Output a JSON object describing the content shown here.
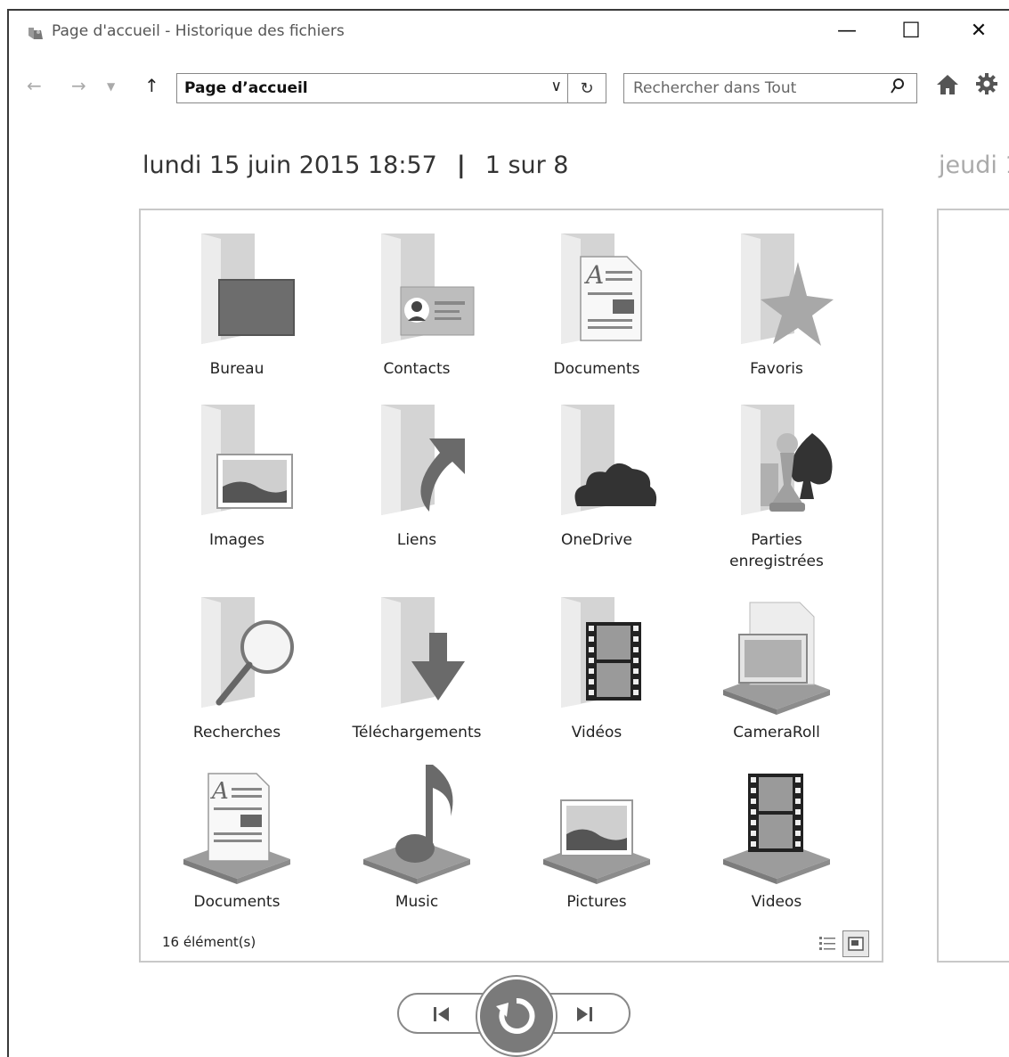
{
  "window": {
    "title": "Page d'accueil - Historique des fichiers",
    "minimize_glyph": "—",
    "maximize_glyph": "☐",
    "close_glyph": "✕"
  },
  "nav": {
    "back_icon": "back-arrow-icon",
    "forward_icon": "forward-arrow-icon",
    "up_icon": "up-arrow-icon",
    "address": "Page d’accueil",
    "search_placeholder": "Rechercher dans Tout"
  },
  "snapshot": {
    "date": "lundi 15 juin 2015 18:57",
    "separator": "|",
    "position": "1 sur 8",
    "next_date_partial": "jeudi 1"
  },
  "items": [
    {
      "label": "Bureau",
      "icon": "desktop-folder-icon"
    },
    {
      "label": "Contacts",
      "icon": "contacts-folder-icon"
    },
    {
      "label": "Documents",
      "icon": "documents-folder-icon"
    },
    {
      "label": "Favoris",
      "icon": "favorites-folder-icon"
    },
    {
      "label": "Images",
      "icon": "pictures-folder-icon"
    },
    {
      "label": "Liens",
      "icon": "links-folder-icon"
    },
    {
      "label": "OneDrive",
      "icon": "onedrive-folder-icon"
    },
    {
      "label": "Parties enregistrées",
      "icon": "saved-games-folder-icon"
    },
    {
      "label": "Recherches",
      "icon": "searches-folder-icon"
    },
    {
      "label": "Téléchargements",
      "icon": "downloads-folder-icon"
    },
    {
      "label": "Vidéos",
      "icon": "videos-folder-icon"
    },
    {
      "label": "CameraRoll",
      "icon": "camera-roll-library-icon"
    },
    {
      "label": "Documents",
      "icon": "documents-library-icon"
    },
    {
      "label": "Music",
      "icon": "music-library-icon"
    },
    {
      "label": "Pictures",
      "icon": "pictures-library-icon"
    },
    {
      "label": "Videos",
      "icon": "videos-library-icon"
    }
  ],
  "status": {
    "count": "16 élément(s)"
  },
  "colors": {
    "folder_back": "#d4d4d4",
    "folder_front": "#e6e6e6",
    "icon_dark": "#6a6a6a",
    "panel_border": "#c8c8c8"
  }
}
